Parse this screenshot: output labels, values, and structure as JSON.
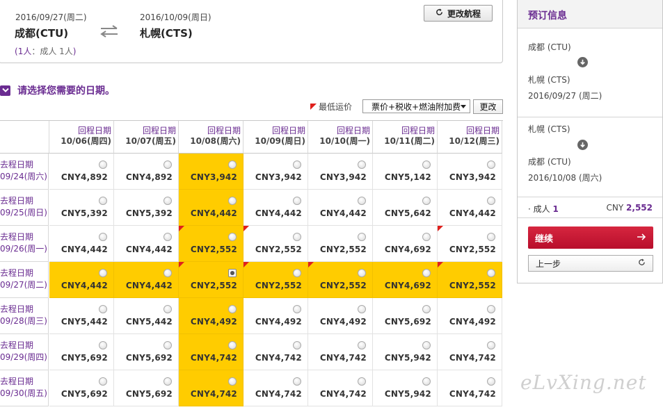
{
  "route": {
    "depart_date": "2016/09/27(周二)",
    "return_date": "2016/10/09(周日)",
    "origin": "成都(CTU)",
    "destination": "札幌(CTS)",
    "pax_count": "1人",
    "pax_detail": "：成人 1人",
    "change_route_label": "更改航程"
  },
  "select": {
    "heading": "请选择您需要的日期。",
    "legend_label": "最低运价",
    "fare_type": "票价+税收+燃油附加费",
    "update_label": "更改"
  },
  "grid": {
    "return_label": "回程日期",
    "depart_label": "去程日期",
    "columns": [
      "10/06(周四)",
      "10/07(周五)",
      "10/08(周六)",
      "10/09(周日)",
      "10/10(周一)",
      "10/11(周二)",
      "10/12(周三)"
    ],
    "rows": [
      {
        "date": "09/24(周六)",
        "prices": [
          "CNY4,892",
          "CNY4,892",
          "CNY3,942",
          "CNY3,942",
          "CNY3,942",
          "CNY5,142",
          "CNY3,942"
        ]
      },
      {
        "date": "09/25(周日)",
        "prices": [
          "CNY5,392",
          "CNY5,392",
          "CNY4,442",
          "CNY4,442",
          "CNY4,442",
          "CNY5,642",
          "CNY4,442"
        ]
      },
      {
        "date": "09/26(周一)",
        "prices": [
          "CNY4,442",
          "CNY4,442",
          "CNY2,552",
          "CNY2,552",
          "CNY2,552",
          "CNY4,692",
          "CNY2,552"
        ]
      },
      {
        "date": "09/27(周二)",
        "prices": [
          "CNY4,442",
          "CNY4,442",
          "CNY2,552",
          "CNY2,552",
          "CNY2,552",
          "CNY4,692",
          "CNY2,552"
        ]
      },
      {
        "date": "09/28(周三)",
        "prices": [
          "CNY5,442",
          "CNY5,442",
          "CNY4,492",
          "CNY4,492",
          "CNY4,492",
          "CNY5,692",
          "CNY4,492"
        ]
      },
      {
        "date": "09/29(周四)",
        "prices": [
          "CNY5,692",
          "CNY5,692",
          "CNY4,742",
          "CNY4,742",
          "CNY4,742",
          "CNY5,942",
          "CNY4,742"
        ]
      },
      {
        "date": "09/30(周五)",
        "prices": [
          "CNY5,692",
          "CNY5,692",
          "CNY4,742",
          "CNY4,742",
          "CNY4,742",
          "CNY5,942",
          "CNY4,742"
        ]
      }
    ],
    "highlight_row": 3,
    "highlight_col": 2,
    "selected": [
      3,
      2
    ],
    "lowest_fare_cells": [
      [
        2,
        2
      ],
      [
        2,
        3
      ],
      [
        2,
        6
      ],
      [
        3,
        2
      ],
      [
        3,
        3
      ],
      [
        3,
        4
      ],
      [
        3,
        6
      ]
    ]
  },
  "summary": {
    "title": "预订信息",
    "outbound_from": "成都 (CTU)",
    "outbound_to": "札幌 (CTS)",
    "outbound_date": "2016/09/27 (周二)",
    "inbound_from": "札幌 (CTS)",
    "inbound_to": "成都 (CTU)",
    "inbound_date": "2016/10/08 (周六)",
    "pax_label": "· 成人",
    "pax_count": "1",
    "currency": "CNY",
    "total": "2,552",
    "continue_label": "继续",
    "prev_label": "上一步"
  },
  "watermark": "eLvXing.net",
  "colors": {
    "accent": "#6a2c91",
    "highlight": "#ffcc00",
    "cta": "#c8102e",
    "lowest_marker": "#e0201c"
  }
}
